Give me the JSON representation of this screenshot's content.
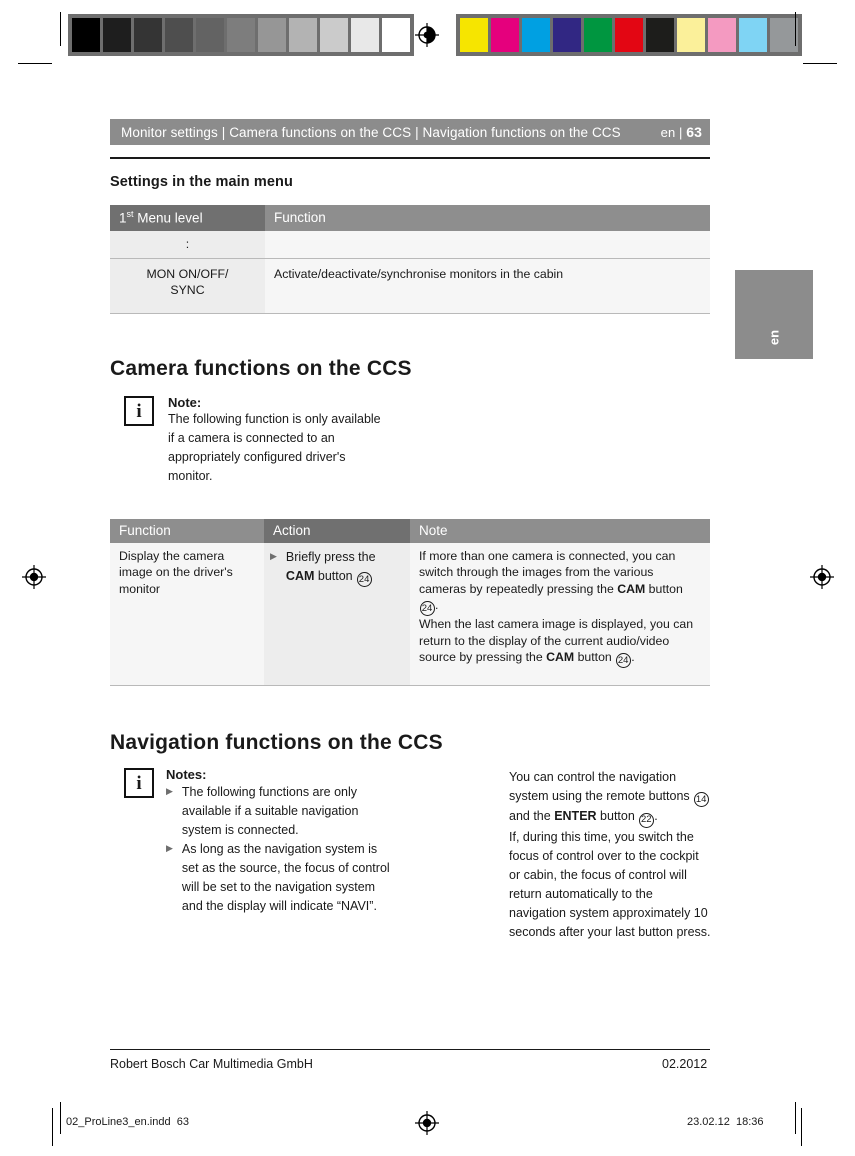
{
  "print_marks": {
    "grayscale_swatches": [
      "#000000",
      "#1e1e1e",
      "#343434",
      "#4e4e4e",
      "#636363",
      "#7d7d7d",
      "#969696",
      "#b3b3b3",
      "#cbcbcb",
      "#e8e8e8",
      "#ffffff"
    ],
    "color_swatches": [
      "#f6e500",
      "#e5007d",
      "#00a0e2",
      "#312783",
      "#009640",
      "#e30613",
      "#1d1d1b",
      "#fbf09a",
      "#f49ac1",
      "#7fd4f4",
      "#95989a"
    ],
    "registration_icon": "registration-target-icon",
    "slug_filename": "02_ProLine3_en.indd",
    "slug_page": "63",
    "slug_date": "23.02.12",
    "slug_time": "18:36"
  },
  "running_header": {
    "breadcrumb": "Monitor settings | Camera functions on the CCS | Navigation functions on the CCS",
    "language": "en",
    "separator": "|",
    "page_number": "63",
    "bar_color": "#8c8c8c"
  },
  "side_tab": {
    "label": "en",
    "color": "#8c8c8c"
  },
  "section_settings": {
    "heading": "Settings in the main menu",
    "table": {
      "headers": [
        "1st Menu level",
        "Function"
      ],
      "header_level_prefix": "1",
      "header_level_sup": "st",
      "header_level_rest": " Menu level",
      "rows": [
        {
          "menu_level": ":",
          "function": ""
        },
        {
          "menu_level": "MON ON/OFF/\nSYNC",
          "function": "Activate/deactivate/synchronise monitors in the cabin"
        }
      ]
    }
  },
  "section_camera": {
    "heading": "Camera functions on the CCS",
    "note": {
      "icon": "info-icon",
      "icon_glyph": "i",
      "title": "Note:",
      "body": "The following function is only available if a camera is connected to an appropriately configured driver's monitor."
    },
    "table": {
      "headers": [
        "Function",
        "Action",
        "Note"
      ],
      "rows": [
        {
          "function": "Display the camera image on the driver's monitor",
          "action_bullet": "▶",
          "action_pre": "Briefly press the ",
          "action_bold": "CAM",
          "action_post": " button ",
          "action_keynum": "24",
          "note_p1_a": "If more than one camera is connected, you can switch through the images from the various cameras by repeatedly pressing the ",
          "note_p1_bold": "CAM",
          "note_p1_b": " button ",
          "note_p1_keynum": "24",
          "note_p1_c": ".",
          "note_p2_a": "When the last camera image is displayed, you can return to the display of the current audio/video source by pressing the ",
          "note_p2_bold": "CAM",
          "note_p2_b": " button ",
          "note_p2_keynum": "24",
          "note_p2_c": "."
        }
      ]
    }
  },
  "section_navigation": {
    "heading": "Navigation functions on the CCS",
    "notes": {
      "icon": "info-icon",
      "icon_glyph": "i",
      "title": "Notes:",
      "bullet_glyph": "▶",
      "items": [
        "The following functions are only available if a suitable navigation system is connected.",
        "As long as the navigation system is set as the source, the focus of control will be set to the navigation system and the display will indicate “NAVI”."
      ]
    },
    "right_column": {
      "p1_a": "You can control the navigation system using the remote buttons ",
      "p1_keynum_1": "14",
      "p1_b": " and the ",
      "p1_bold": "ENTER",
      "p1_c": " button ",
      "p1_keynum_2": "22",
      "p1_d": ".",
      "p2": "If, during this time, you switch the focus of control over to the cockpit or cabin, the focus of control will return automatically to the navigation system approximately 10 seconds after your last button press."
    }
  },
  "footer": {
    "company": "Robert Bosch Car Multimedia GmbH",
    "date": "02.2012"
  }
}
